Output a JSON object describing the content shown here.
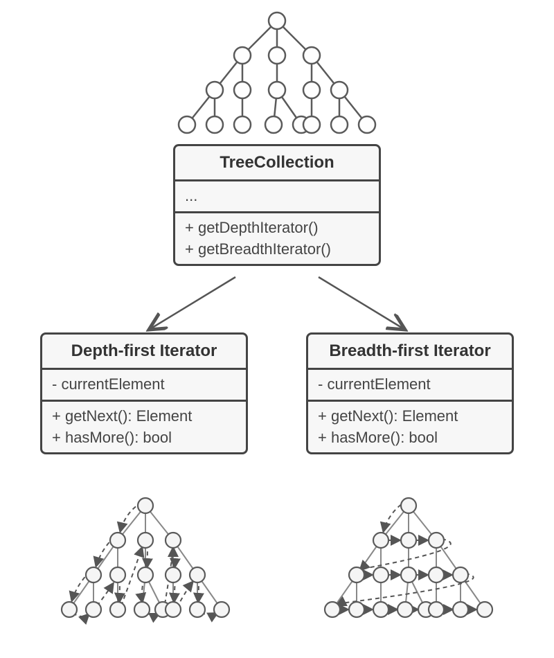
{
  "treeCollection": {
    "title": "TreeCollection",
    "fields": "...",
    "method1": "+ getDepthIterator()",
    "method2": "+ getBreadthIterator()"
  },
  "depthIterator": {
    "title": "Depth-first Iterator",
    "field1": "- currentElement",
    "method1": "+ getNext(): Element",
    "method2": "+ hasMore(): bool"
  },
  "breadthIterator": {
    "title": "Breadth-first Iterator",
    "field1": "- currentElement",
    "method1": "+ getNext(): Element",
    "method2": "+ hasMore(): bool"
  }
}
